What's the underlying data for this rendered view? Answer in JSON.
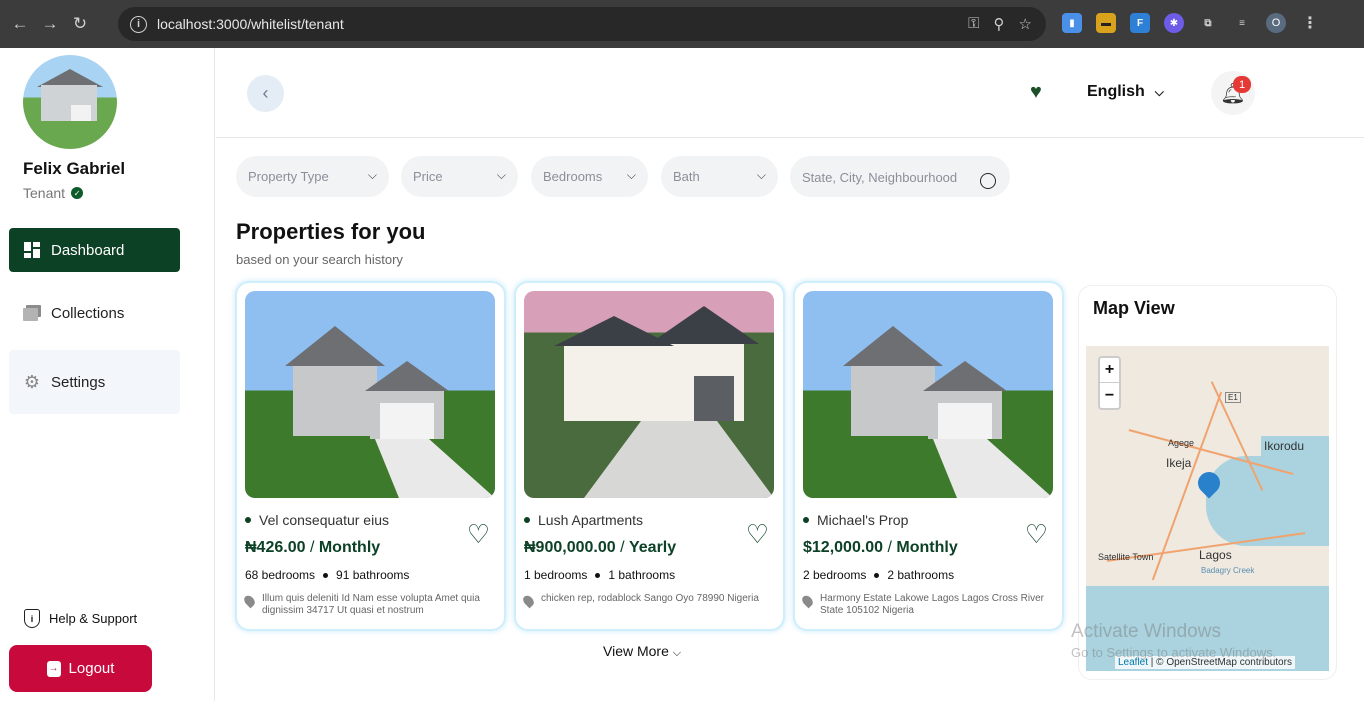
{
  "browser": {
    "url": "localhost:3000/whitelist/tenant",
    "profile_initial": "O"
  },
  "user": {
    "name": "Felix Gabriel",
    "role": "Tenant"
  },
  "sidebar": {
    "items": [
      {
        "label": "Dashboard"
      },
      {
        "label": "Collections"
      },
      {
        "label": "Settings"
      }
    ],
    "help_label": "Help & Support",
    "logout_label": "Logout"
  },
  "header": {
    "language": "English",
    "notification_count": "1"
  },
  "filters": {
    "property_type": "Property Type",
    "price": "Price",
    "bedrooms": "Bedrooms",
    "bath": "Bath",
    "search_placeholder": "State, City, Neighbourhood"
  },
  "section": {
    "title": "Properties for you",
    "subtitle": "based on your search history",
    "view_more": "View More"
  },
  "listings": [
    {
      "title": "Vel consequatur eius",
      "price": "₦426.00",
      "period": "Monthly",
      "bedrooms": "68 bedrooms",
      "bathrooms": "91 bathrooms",
      "address": "Illum quis deleniti Id Nam esse volupta Amet quia dignissim 34717 Ut quasi et nostrum"
    },
    {
      "title": "Lush Apartments",
      "price": "₦900,000.00",
      "period": "Yearly",
      "bedrooms": "1 bedrooms",
      "bathrooms": "1 bathrooms",
      "address": "chicken rep, rodablock Sango Oyo 78990 Nigeria"
    },
    {
      "title": "Michael's Prop",
      "price": "$12,000.00",
      "period": "Monthly",
      "bedrooms": "2 bedrooms",
      "bathrooms": "2 bathrooms",
      "address": "Harmony Estate Lakowe Lagos Lagos Cross River State 105102 Nigeria"
    }
  ],
  "map": {
    "title": "Map View",
    "zoom_in": "+",
    "zoom_out": "−",
    "labels": {
      "ikorodu": "Ikorodu",
      "ikeja": "Ikeja",
      "agege": "Agege",
      "lagos": "Lagos",
      "satellite_town": "Satellite Town",
      "e1": "E1",
      "badagry_creek": "Badagry Creek"
    },
    "attribution_link": "Leaflet",
    "attribution_text": " | © OpenStreetMap contributors"
  },
  "watermark": {
    "line1": "Activate Windows",
    "line2": "Go to Settings to activate Windows."
  },
  "colors": {
    "brand_green": "#0d4125",
    "logout_red": "#c8093c",
    "badge_red": "#e53935"
  }
}
